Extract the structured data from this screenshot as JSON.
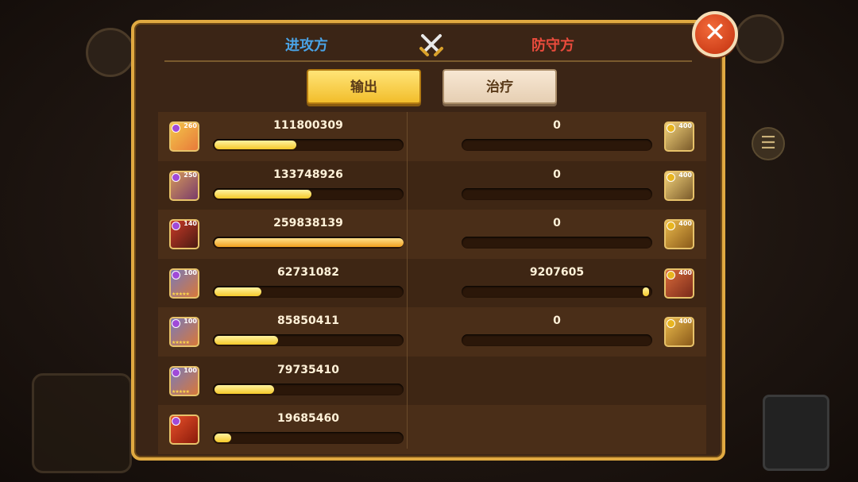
{
  "header": {
    "attack_label": "进攻方",
    "defense_label": "防守方",
    "crossed_swords_icon": "crossed-swords-icon"
  },
  "tabs": [
    {
      "label": "输出",
      "active": true
    },
    {
      "label": "治疗",
      "active": false
    }
  ],
  "attackers": [
    {
      "value": "111800309",
      "fill": 0.43,
      "level": "260",
      "portrait": "blonde-hero-portrait"
    },
    {
      "value": "133748926",
      "fill": 0.51,
      "level": "250",
      "portrait": "masked-warrior-portrait"
    },
    {
      "value": "259838139",
      "fill": 1.0,
      "level": "140",
      "portrait": "red-beast-portrait"
    },
    {
      "value": "62731082",
      "fill": 0.24,
      "level": "100",
      "stars": "★★★★★",
      "portrait": "armored-knight-portrait"
    },
    {
      "value": "85850411",
      "fill": 0.33,
      "level": "100",
      "stars": "★★★★★",
      "portrait": "armored-knight-portrait"
    },
    {
      "value": "79735410",
      "fill": 0.31,
      "level": "100",
      "stars": "★★★★★",
      "portrait": "armored-knight-portrait"
    },
    {
      "value": "19685460",
      "fill": 0.08,
      "portrait": "red-dragon-portrait"
    }
  ],
  "defenders": [
    {
      "value": "0",
      "fill": 0.0,
      "level": "400",
      "portrait": "golden-armor-portrait"
    },
    {
      "value": "0",
      "fill": 0.0,
      "level": "400",
      "portrait": "golden-armor-portrait"
    },
    {
      "value": "0",
      "fill": 0.0,
      "level": "400",
      "portrait": "golden-mech-portrait"
    },
    {
      "value": "9207605",
      "fill": 0.035,
      "level": "400",
      "portrait": "lion-warrior-portrait"
    },
    {
      "value": "0",
      "fill": 0.0,
      "level": "400",
      "portrait": "golden-mech-portrait"
    }
  ],
  "colors": {
    "attack": "#4aa3e6",
    "defense": "#ea4b3c",
    "bar_fill": "#f5c92a",
    "panel_border": "#e0a941"
  },
  "close_icon": "close-icon",
  "menu_icon": "list-icon"
}
